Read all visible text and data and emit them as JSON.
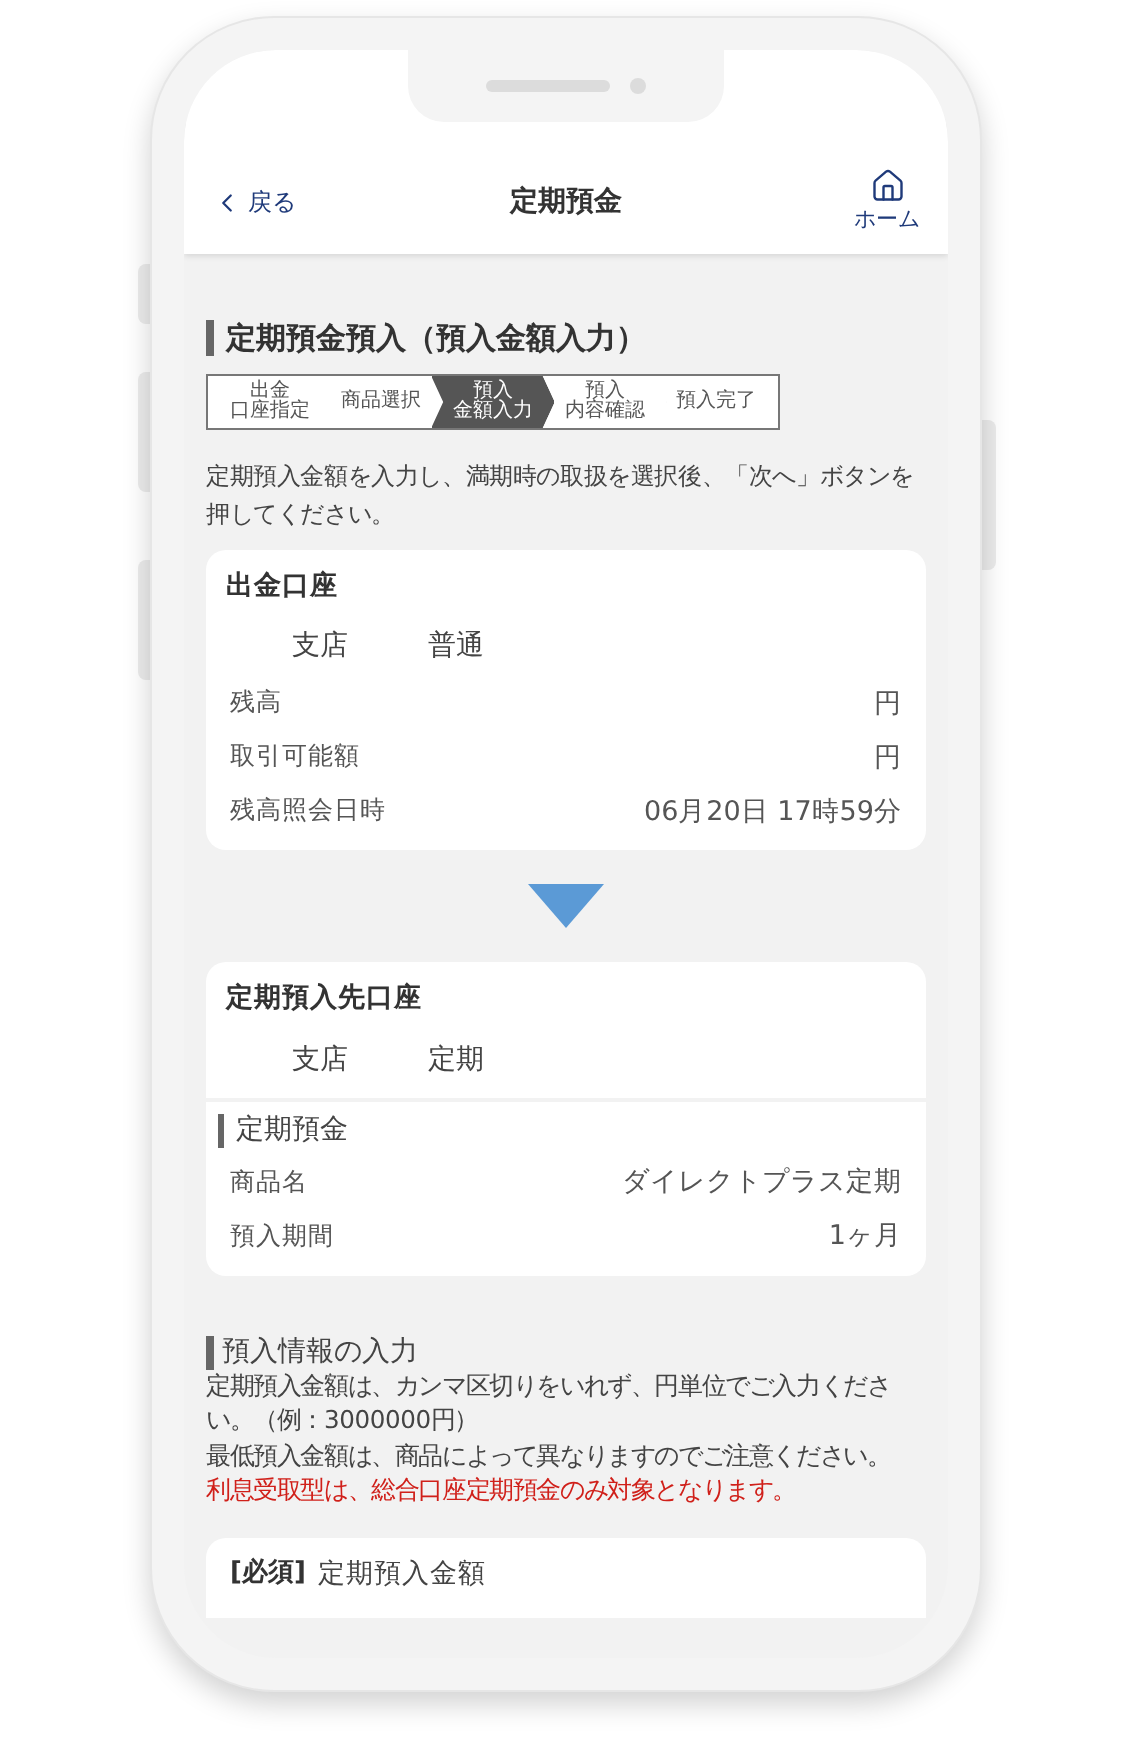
{
  "header": {
    "back": "戻る",
    "title": "定期預金",
    "home": "ホーム"
  },
  "page_title": "定期預金預入（預入金額入力）",
  "steps": [
    {
      "lines": [
        "出金",
        "口座指定"
      ],
      "selected": false
    },
    {
      "lines": [
        "商品選択"
      ],
      "selected": false
    },
    {
      "lines": [
        "預入",
        "金額入力"
      ],
      "selected": true
    },
    {
      "lines": [
        "預入",
        "内容確認"
      ],
      "selected": false
    },
    {
      "lines": [
        "預入完了"
      ],
      "selected": false
    }
  ],
  "instruction": "定期預入金額を入力し、満期時の取扱を選択後、「次へ」ボタンを押してください。",
  "source_account": {
    "title": "出金口座",
    "branch": "支店",
    "type": "普通",
    "rows": [
      {
        "label": "残高",
        "value": "円"
      },
      {
        "label": "取引可能額",
        "value": "円"
      },
      {
        "label": "残高照会日時",
        "value": "06月20日 17時59分"
      }
    ]
  },
  "destination_account": {
    "title": "定期預入先口座",
    "branch": "支店",
    "type": "定期",
    "section": "定期預金",
    "rows": [
      {
        "label": "商品名",
        "value": "ダイレクトプラス定期"
      },
      {
        "label": "預入期間",
        "value": "1ヶ月"
      }
    ]
  },
  "input_info": {
    "title": "預入情報の入力",
    "notes": [
      {
        "text": "定期預入金額は、カンマ区切りをいれず、円単位でご入力ください。（例：3000000円）",
        "kind": "normal"
      },
      {
        "text": "最低預入金額は、商品によって異なりますのでご注意ください。",
        "kind": "normal"
      },
      {
        "text": "利息受取型は、総合口座定期預金のみ対象となります。",
        "kind": "warning"
      }
    ]
  },
  "amount_field": {
    "required": "[必須]",
    "label": "定期預入金額"
  }
}
